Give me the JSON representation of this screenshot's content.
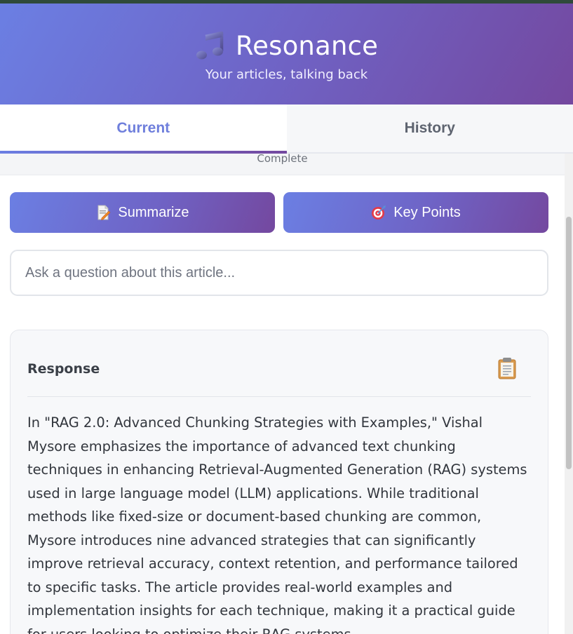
{
  "header": {
    "title": "Resonance",
    "subtitle": "Your articles, talking back",
    "icon": "music-note-icon"
  },
  "tabs": [
    {
      "label": "Current",
      "active": true
    },
    {
      "label": "History",
      "active": false
    }
  ],
  "status": {
    "text": "Complete"
  },
  "actions": {
    "summarize_label": "Summarize",
    "summarize_icon": "memo-icon",
    "keypoints_label": "Key Points",
    "keypoints_icon": "target-icon"
  },
  "question": {
    "placeholder": "Ask a question about this article...",
    "value": ""
  },
  "response": {
    "title": "Response",
    "copy_icon": "clipboard-icon",
    "text": "In \"RAG 2.0: Advanced Chunking Strategies with Examples,\" Vishal Mysore emphasizes the importance of advanced text chunking techniques in enhancing Retrieval-Augmented Generation (RAG) systems used in large language model (LLM) applications. While traditional methods like fixed-size or document-based chunking are common, Mysore introduces nine advanced strategies that can significantly improve retrieval accuracy, context retention, and performance tailored to specific tasks. The article provides real-world examples and implementation insights for each technique, making it a practical guide for users looking to optimize their RAG systems."
  },
  "colors": {
    "gradient_start": "#6b7fe3",
    "gradient_end": "#74489f",
    "active_tab": "#6f7fdc"
  }
}
